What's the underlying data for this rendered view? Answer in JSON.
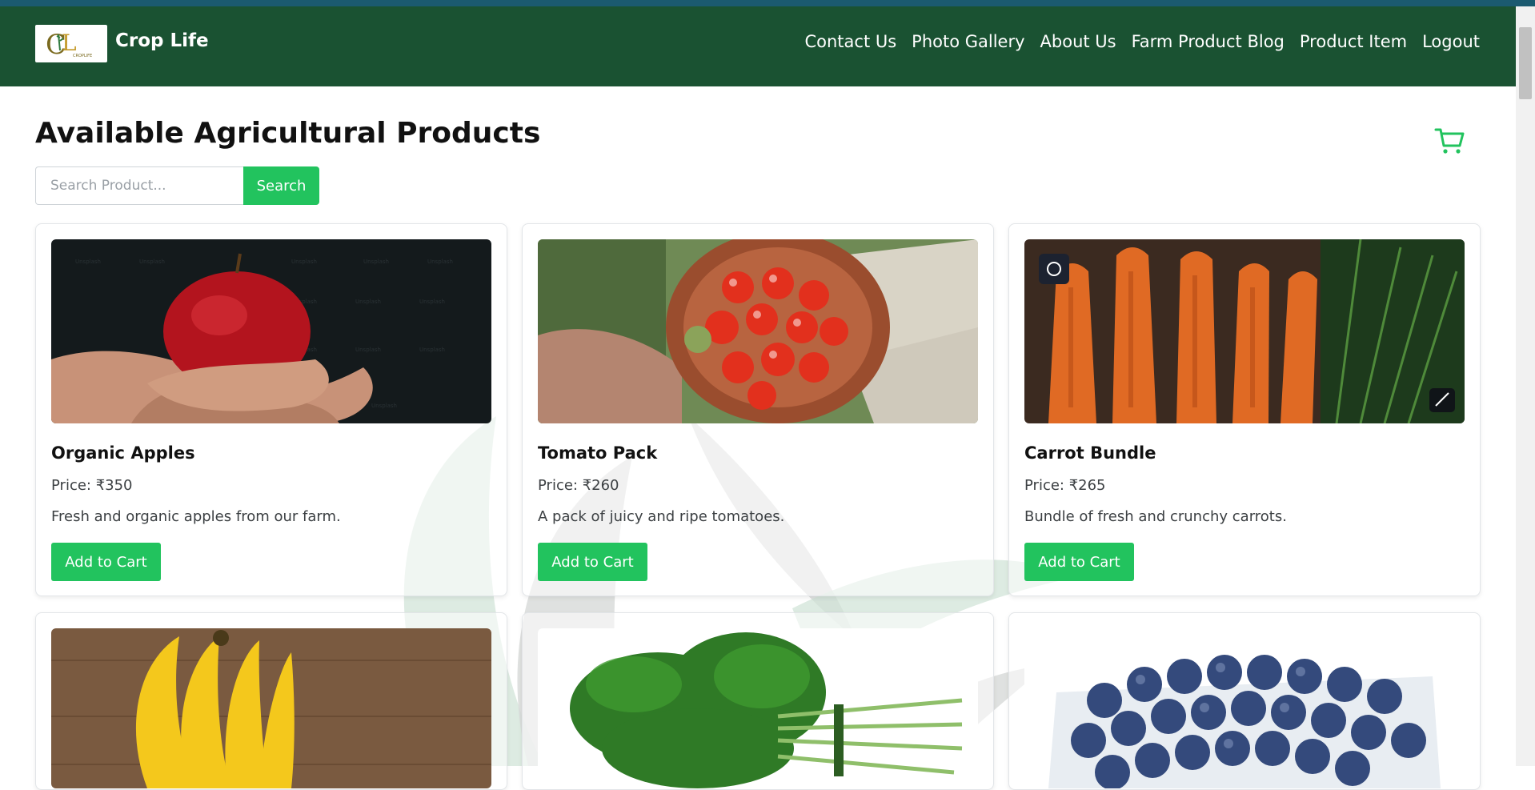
{
  "header": {
    "brand": "Crop Life",
    "nav": [
      "Contact Us",
      "Photo Gallery",
      "About Us",
      "Farm Product Blog",
      "Product Item",
      "Logout"
    ]
  },
  "page": {
    "title": "Available Agricultural Products"
  },
  "search": {
    "placeholder": "Search Product...",
    "button_label": "Search"
  },
  "products": [
    {
      "name": "Organic Apples",
      "price": "Price: ₹350",
      "description": "Fresh and organic apples from our farm.",
      "button": "Add to Cart",
      "image": "apple-in-hands"
    },
    {
      "name": "Tomato Pack",
      "price": "Price: ₹260",
      "description": "A pack of juicy and ripe tomatoes.",
      "button": "Add to Cart",
      "image": "tomato-bowl"
    },
    {
      "name": "Carrot Bundle",
      "price": "Price: ₹265",
      "description": "Bundle of fresh and crunchy carrots.",
      "button": "Add to Cart",
      "image": "carrots"
    }
  ],
  "more_products": [
    {
      "image": "bananas"
    },
    {
      "image": "spinach"
    },
    {
      "image": "blueberries"
    }
  ],
  "colors": {
    "header": "#1a5232",
    "accent": "#22c35e"
  },
  "icons": {
    "cart": "cart-icon"
  }
}
